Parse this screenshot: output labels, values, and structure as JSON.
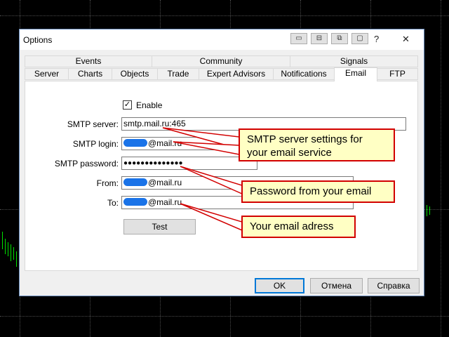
{
  "window": {
    "title": "Options",
    "help_glyph": "?",
    "close_glyph": "✕"
  },
  "title_buttons": [
    "▭",
    "⊟",
    "⧉",
    "▢"
  ],
  "tabs_top": [
    "Events",
    "Community",
    "Signals"
  ],
  "tabs_bottom": [
    "Server",
    "Charts",
    "Objects",
    "Trade",
    "Expert Advisors",
    "Notifications",
    "Email",
    "FTP"
  ],
  "active_tab": "Email",
  "form": {
    "enable_label": "Enable",
    "enable_checked": "✓",
    "smtp_server_label": "SMTP server:",
    "smtp_server_value": "smtp.mail.ru:465",
    "smtp_login_label": "SMTP login:",
    "smtp_login_value": "@mail.ru",
    "smtp_password_label": "SMTP password:",
    "smtp_password_value": "●●●●●●●●●●●●●●",
    "from_label": "From:",
    "from_value": "@mail.ru",
    "to_label": "To:",
    "to_value": "@mail.ru",
    "test_label": "Test"
  },
  "buttons": {
    "ok": "OK",
    "cancel": "Отмена",
    "help": "Справка"
  },
  "callouts": {
    "server": [
      "SMTP server settings for",
      "your email service"
    ],
    "password": "Password from your email",
    "address": "Your email adress"
  },
  "colors": {
    "callout_border": "#d20000",
    "callout_bg": "#ffffc4",
    "chart_bg": "#000000",
    "candle": "#00e000",
    "redacted": "#1a73e8"
  }
}
